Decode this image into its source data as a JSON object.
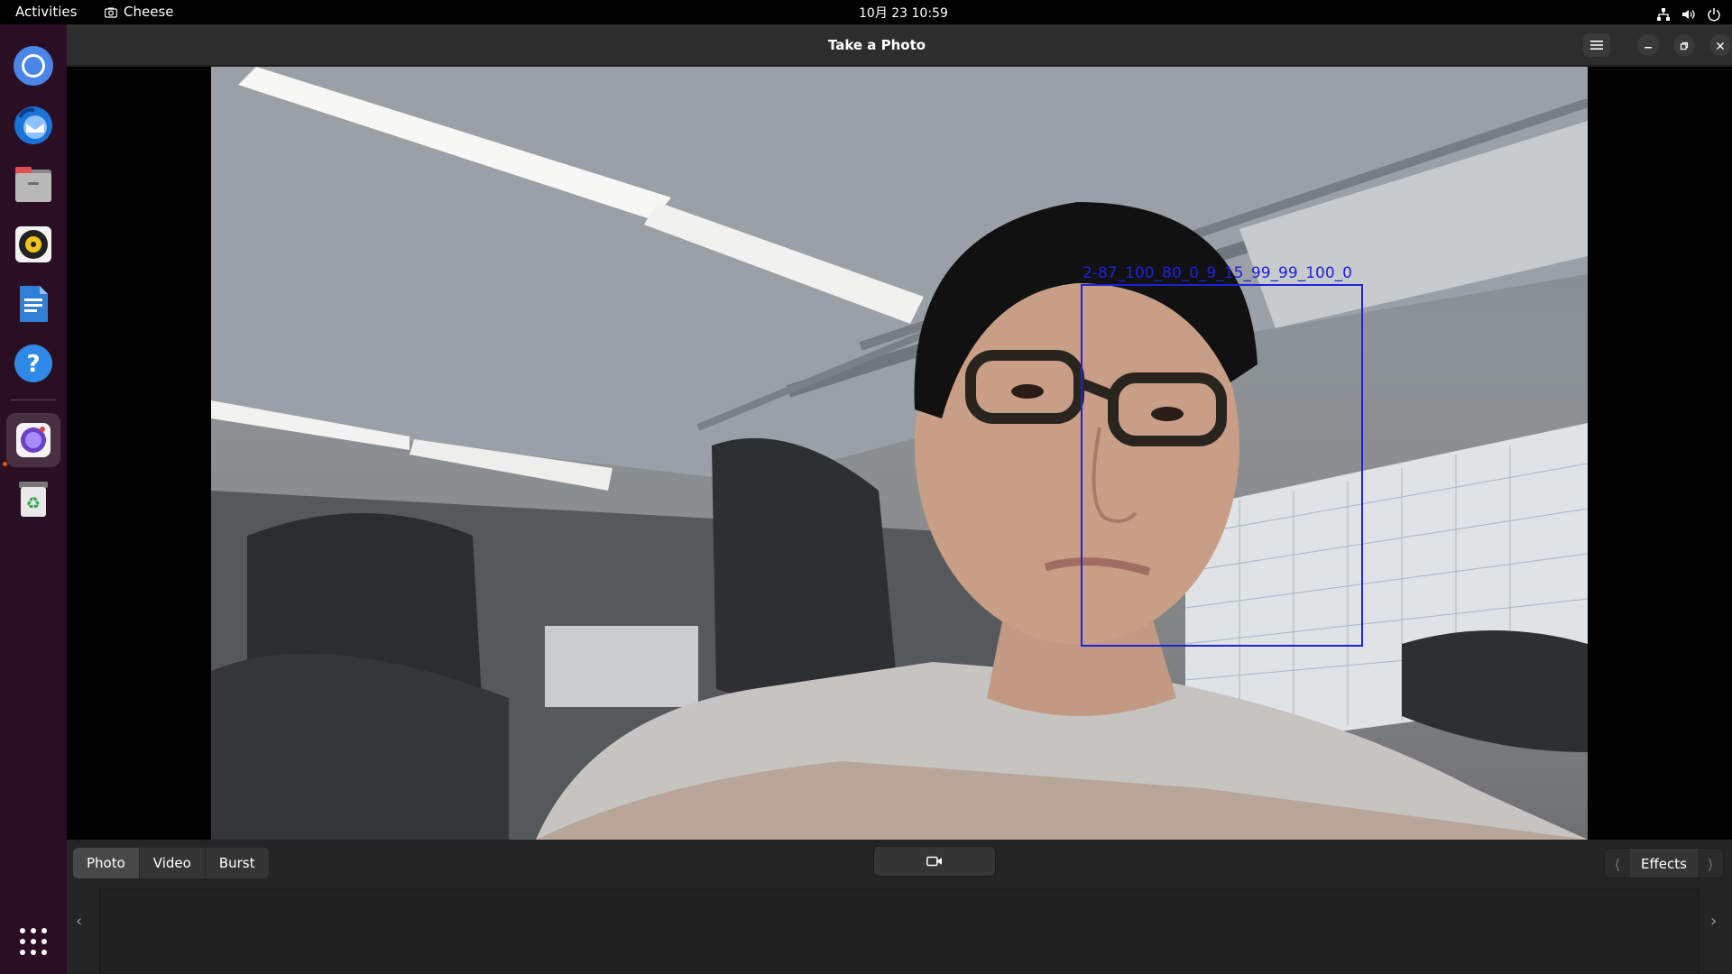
{
  "topbar": {
    "activities": "Activities",
    "app_name": "Cheese",
    "clock": "10月 23  10:59",
    "tray": [
      "network-icon",
      "volume-icon",
      "power-icon"
    ]
  },
  "dock": {
    "items": [
      {
        "name": "chromium-icon"
      },
      {
        "name": "thunderbird-icon"
      },
      {
        "name": "files-icon"
      },
      {
        "name": "rhythmbox-icon"
      },
      {
        "name": "writer-icon"
      },
      {
        "name": "help-icon"
      },
      {
        "name": "cheese-icon",
        "active": true
      },
      {
        "name": "trash-icon"
      }
    ],
    "apps_grid": "show-apps-icon"
  },
  "window": {
    "title": "Take a Photo",
    "controls": [
      "menu-icon",
      "minimize-icon",
      "maximize-icon",
      "close-icon"
    ]
  },
  "feed": {
    "face_label": "2-87_100_80_0_9_15_99_99_100_0",
    "box_color": "#1f22d6"
  },
  "toolbar": {
    "modes": [
      "Photo",
      "Video",
      "Burst"
    ],
    "selected_mode": "Photo",
    "capture_icon": "camera-icon",
    "effects_label": "Effects"
  },
  "colors": {
    "dock_bg": "#2a0f24",
    "window_bg": "#242424",
    "accent": "#e95420"
  }
}
